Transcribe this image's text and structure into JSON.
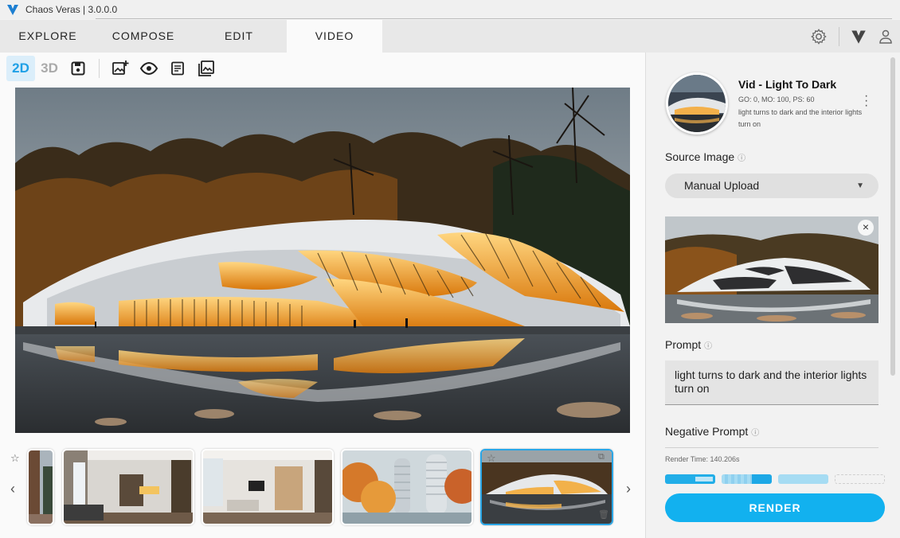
{
  "window": {
    "title": "Chaos Veras | 3.0.0.0"
  },
  "tabs": [
    {
      "label": "EXPLORE"
    },
    {
      "label": "COMPOSE"
    },
    {
      "label": "EDIT"
    },
    {
      "label": "VIDEO",
      "active": true
    }
  ],
  "toolbar": {
    "mode_2d": "2D",
    "mode_3d": "3D",
    "active_mode": "2D"
  },
  "thumbnails": {
    "count_visible": 5,
    "selected_index": 4
  },
  "preset": {
    "title": "Vid - Light To Dark",
    "params": "GO: 0, MO: 100, PS: 60",
    "description": "light turns to dark and the interior lights turn on"
  },
  "source_image": {
    "label": "Source Image",
    "selected": "Manual Upload"
  },
  "prompt": {
    "label": "Prompt",
    "value": "light turns to dark and the interior lights turn on"
  },
  "negative_prompt": {
    "label": "Negative Prompt"
  },
  "render": {
    "time": "Render Time: 140.206s",
    "button": "RENDER"
  },
  "colors": {
    "accent": "#12b1ef",
    "active_tab_bg": "#fafafa"
  }
}
